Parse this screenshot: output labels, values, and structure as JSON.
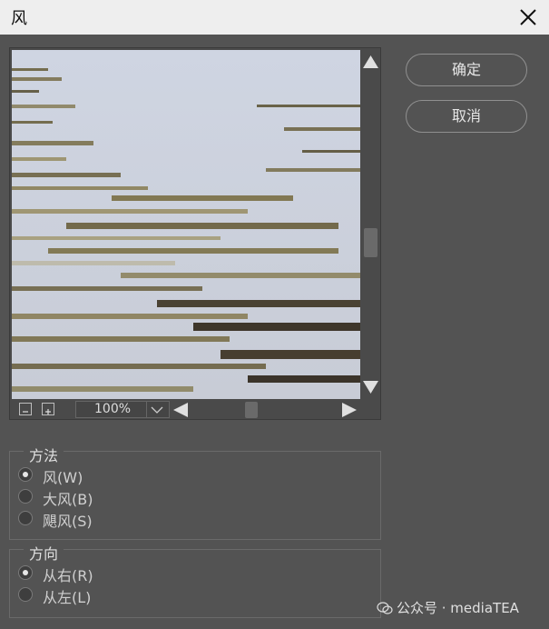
{
  "window": {
    "title": "风"
  },
  "preview": {
    "zoom": "100%"
  },
  "buttons": {
    "ok": "确定",
    "cancel": "取消"
  },
  "method": {
    "legend": "方法",
    "options": [
      {
        "label": "风(W)",
        "selected": true
      },
      {
        "label": "大风(B)",
        "selected": false
      },
      {
        "label": "飓风(S)",
        "selected": false
      }
    ]
  },
  "direction": {
    "legend": "方向",
    "options": [
      {
        "label": "从右(R)",
        "selected": true
      },
      {
        "label": "从左(L)",
        "selected": false
      }
    ]
  },
  "watermark": "公众号 · mediaTEA",
  "colors": {
    "background": "#535353",
    "titlebar": "#eeeeee",
    "accent": "#e6e6e6"
  }
}
